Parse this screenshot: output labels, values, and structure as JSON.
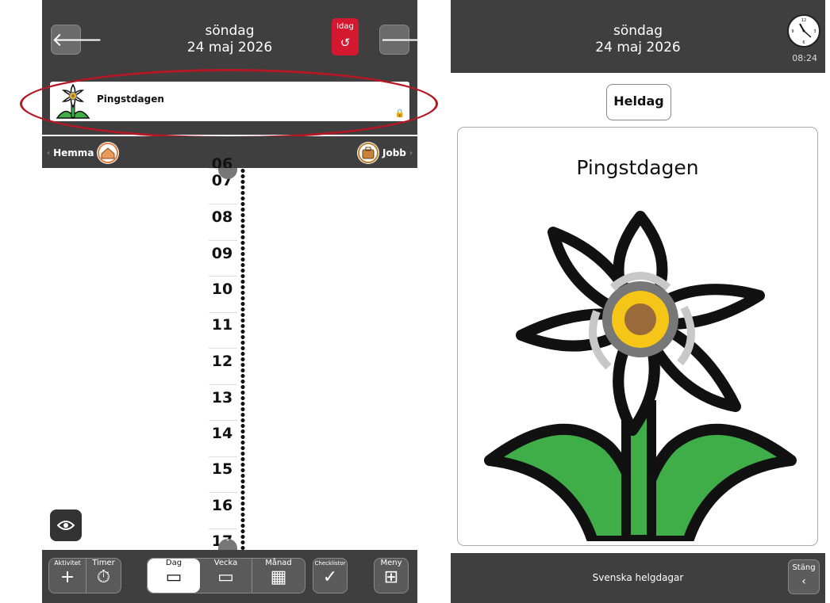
{
  "left": {
    "header": {
      "weekday": "söndag",
      "date": "24 maj 2026",
      "today_label": "Idag",
      "today_icon": "↺",
      "prev_icon": "🡐",
      "next_icon": "🡒"
    },
    "allday_event": {
      "title": "Pingstdagen",
      "lock_icon": "🔒"
    },
    "categories": {
      "left": "Hemma",
      "right": "Jobb",
      "left_chevron": "‹",
      "right_chevron": "›"
    },
    "hours": [
      "06",
      "07",
      "08",
      "09",
      "10",
      "11",
      "12",
      "13",
      "14",
      "15",
      "16",
      "17"
    ],
    "bottom": {
      "aktivitet": "Aktivitet",
      "timer": "Timer",
      "dag": "Dag",
      "vecka": "Vecka",
      "manad": "Månad",
      "checklistor": "Checklistor",
      "meny": "Meny"
    }
  },
  "right": {
    "header": {
      "weekday": "söndag",
      "date": "24 maj 2026",
      "clock_time": "08:24"
    },
    "allday_button": "Heldag",
    "event_title": "Pingstdagen",
    "calendar_name": "Svenska helgdagar",
    "close_label": "Stäng",
    "close_icon": "‹"
  },
  "colors": {
    "bar": "#3f3f3f",
    "today": "#d3182f",
    "highlight": "#b51825",
    "flower_yellow": "#f5c518",
    "flower_center": "#9a6a3a",
    "leaf_green": "#3fae49"
  }
}
